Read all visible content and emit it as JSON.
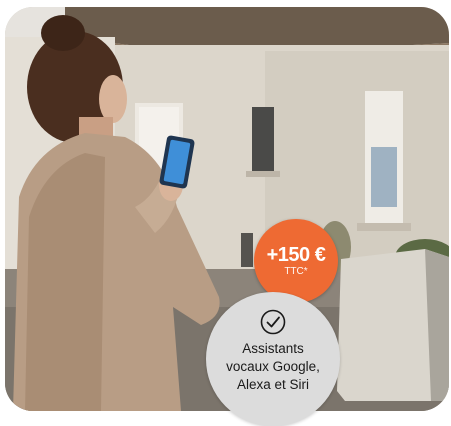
{
  "promo": {
    "price": "+150 €",
    "price_note": "TTC*"
  },
  "feature": {
    "icon": "check-circle-icon",
    "lines": [
      "Assistants",
      "vocaux Google,",
      "Alexa et Siri"
    ]
  },
  "colors": {
    "accent": "#ee6a33",
    "feature_badge": "#dcdcdc",
    "phone_screen": "#3f8fd8"
  }
}
